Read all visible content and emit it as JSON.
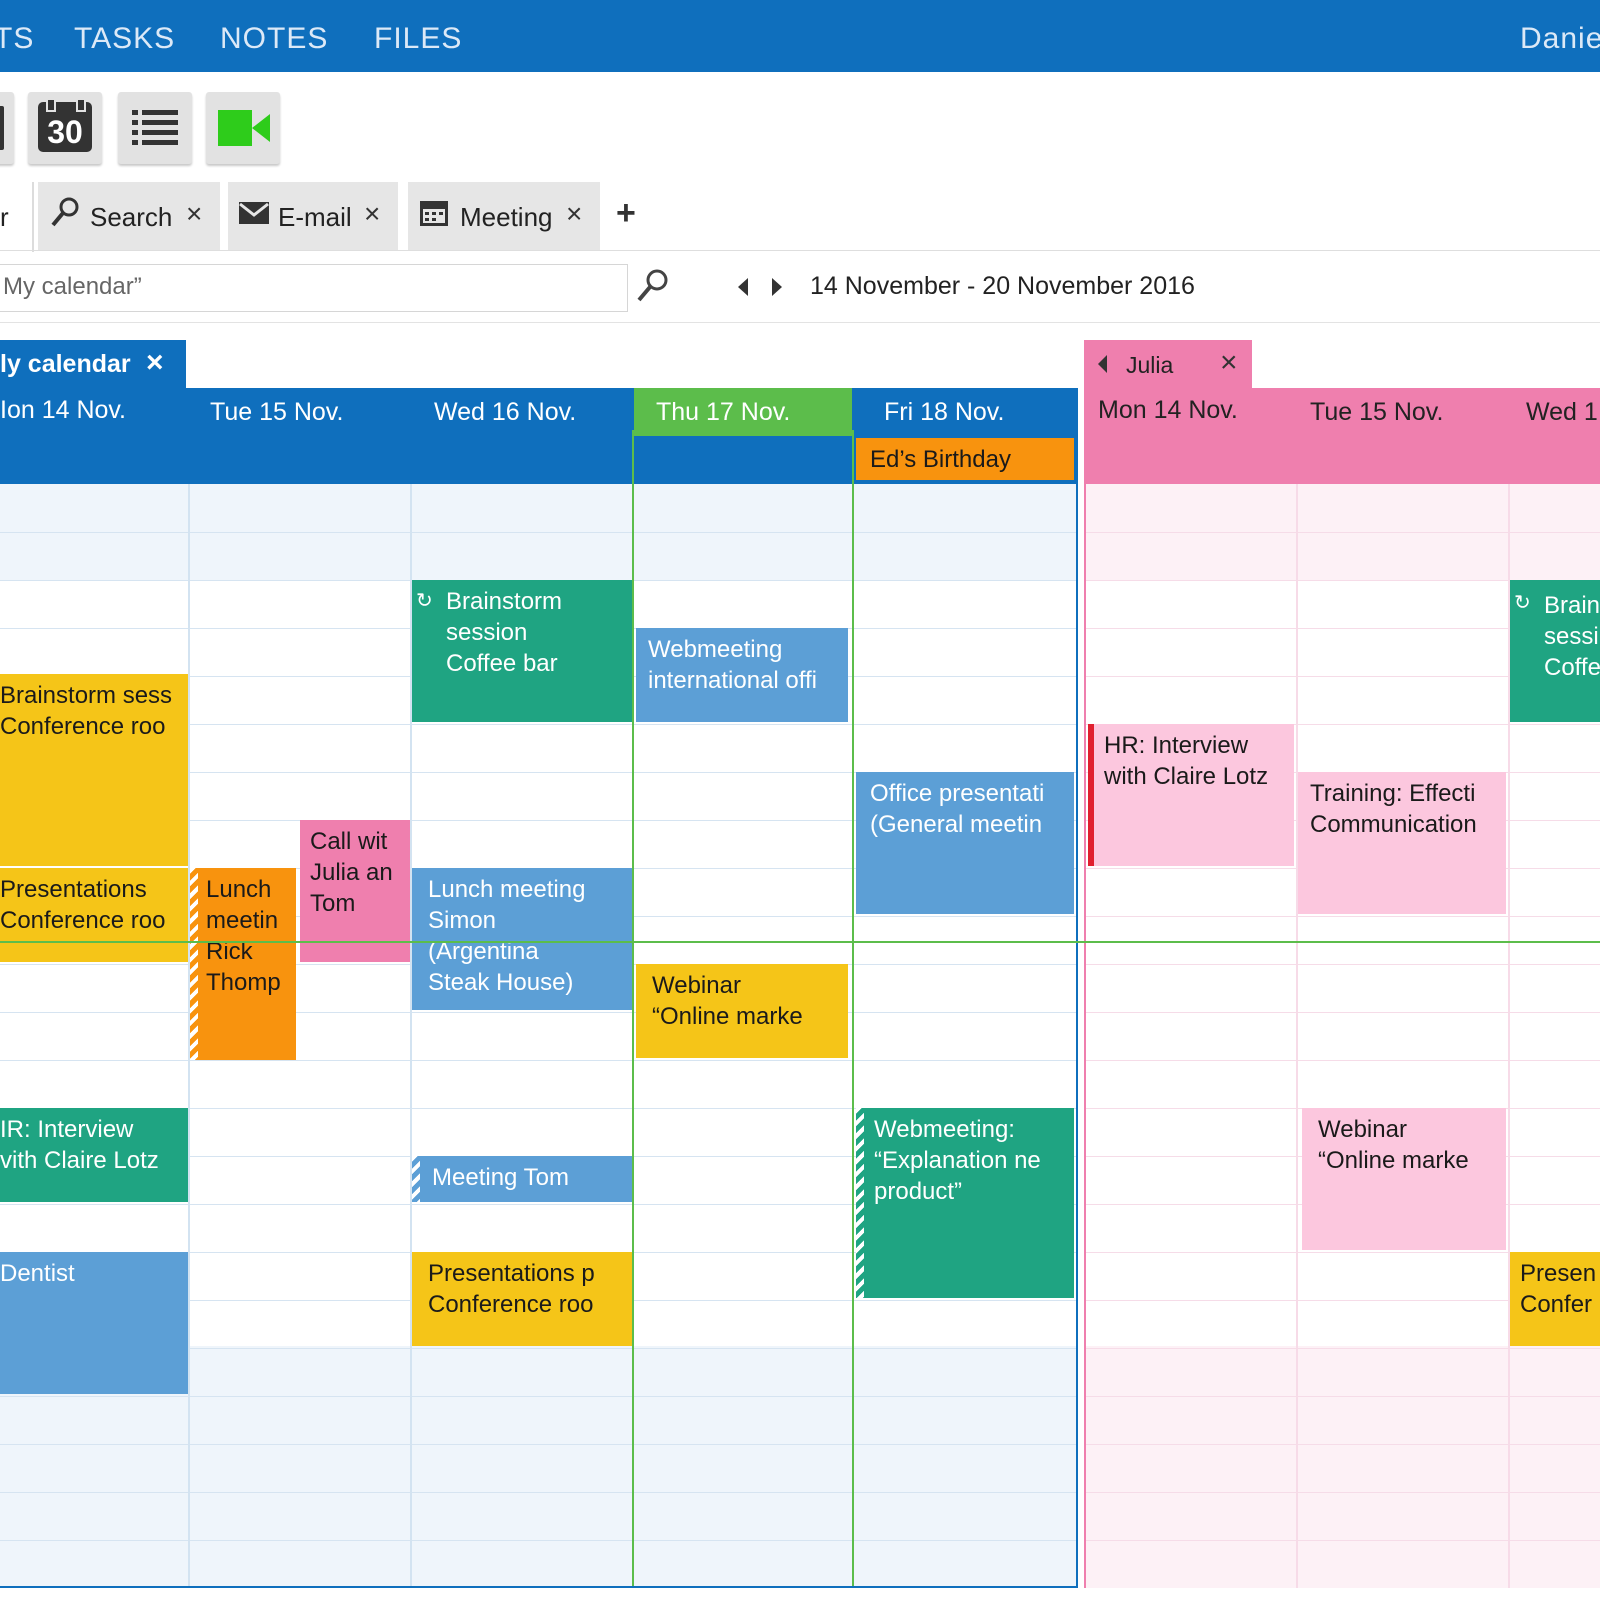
{
  "nav": {
    "items": [
      "TS",
      "TASKS",
      "NOTES",
      "FILES"
    ],
    "user": "Danie"
  },
  "toolbar": {
    "calendar_day": "30"
  },
  "tabs": {
    "partial": "r",
    "items": [
      "Search",
      "E-mail",
      "Meeting"
    ],
    "close": "×",
    "add": "+"
  },
  "search": {
    "value": "My calendar”"
  },
  "date_range": "14 November - 20 November 2016",
  "my_calendar": {
    "title": "ly calendar",
    "close": "×",
    "days": [
      "Ion 14 Nov.",
      "Tue 15 Nov.",
      "Wed 16 Nov.",
      "Thu 17 Nov.",
      "Fri 18 Nov."
    ],
    "allday_event": "Ed’s Birthday"
  },
  "julia": {
    "title": "Julia",
    "close": "×",
    "days": [
      "Mon 14 Nov.",
      "Tue 15 Nov.",
      "Wed 1"
    ]
  },
  "events": [
    {
      "id": "mon-brainstorm",
      "text": "Brainstorm sess\nConference roo",
      "color": "yellow"
    },
    {
      "id": "mon-presentations",
      "text": "Presentations\nConference roo",
      "color": "yellow"
    },
    {
      "id": "mon-hr",
      "text": "IR: Interview\nvith Claire Lotz",
      "color": "green"
    },
    {
      "id": "mon-dentist",
      "text": "Dentist",
      "color": "blue"
    },
    {
      "id": "tue-lunch",
      "text": "Lunch\nmeetin\nRick\nThomp",
      "color": "orange"
    },
    {
      "id": "tue-call",
      "text": "Call wit\nJulia an\nTom",
      "color": "pink"
    },
    {
      "id": "wed-brainstorm",
      "text": "Brainstorm\nsession\nCoffee bar",
      "color": "green",
      "recurring": true
    },
    {
      "id": "wed-lunch",
      "text": "Lunch meeting\nSimon\n(Argentina\nSteak House)",
      "color": "blue"
    },
    {
      "id": "wed-meeting-tom",
      "text": "Meeting Tom",
      "color": "blue"
    },
    {
      "id": "wed-presentations",
      "text": "Presentations p\nConference roo",
      "color": "yellow"
    },
    {
      "id": "thu-webmeeting",
      "text": "Webmeeting\ninternational offi",
      "color": "blue"
    },
    {
      "id": "thu-webinar",
      "text": "Webinar\n“Online marke",
      "color": "yellow"
    },
    {
      "id": "fri-office",
      "text": "Office presentati\n(General meetin",
      "color": "blue"
    },
    {
      "id": "fri-webmeeting",
      "text": "Webmeeting:\n“Explanation ne\nproduct”",
      "color": "green"
    },
    {
      "id": "julia-hr",
      "text": "HR: Interview\nwith Claire Lotz",
      "color": "pink-light"
    },
    {
      "id": "julia-training",
      "text": "Training: Effecti\nCommunication",
      "color": "pink-light"
    },
    {
      "id": "julia-webinar",
      "text": "Webinar\n“Online marke",
      "color": "pink-light"
    },
    {
      "id": "julia-brainstorm",
      "text": "Brain\nsessi\nCoffe",
      "color": "green",
      "recurring": true
    },
    {
      "id": "julia-presentations",
      "text": "Presen\nConfer",
      "color": "yellow"
    }
  ],
  "colors": {
    "nav": "#0f6fbd",
    "header_blue": "#0f6fbd",
    "today_green": "#5cbd4b",
    "julia_pink": "#ef7fae",
    "green": "#1fa482",
    "blue": "#5c9fd6",
    "yellow": "#f5c518",
    "orange": "#f8930e",
    "pink_light": "#fcc7de",
    "video_green": "#2ecc1b"
  },
  "icons": [
    "calendar-30-icon",
    "list-view-icon",
    "video-camera-icon",
    "search-icon",
    "envelope-icon",
    "calendar-icon",
    "prev-arrow-icon",
    "next-arrow-icon",
    "recurring-icon",
    "add-icon"
  ]
}
